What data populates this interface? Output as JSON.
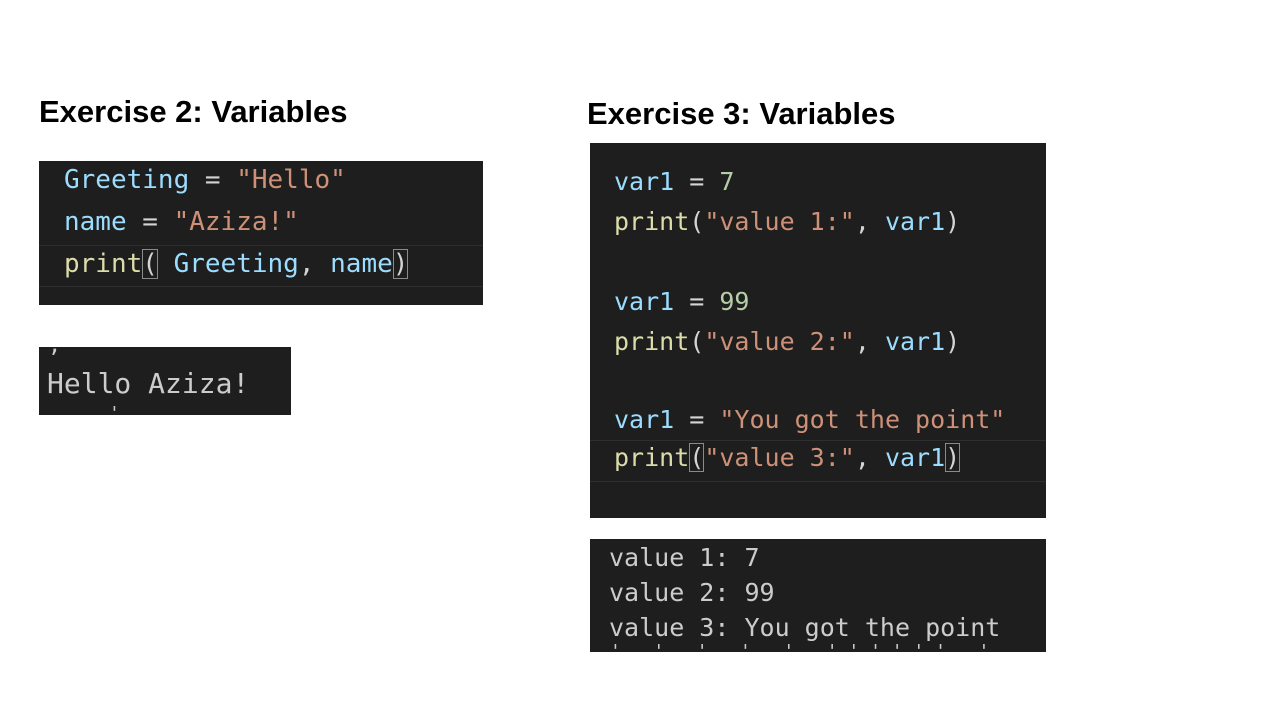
{
  "exercise2": {
    "title": "Exercise 2: Variables",
    "code": {
      "line1": {
        "var": "Greeting",
        "op": " = ",
        "str": "\"Hello\""
      },
      "line2": {
        "var": "name",
        "op": " = ",
        "str": "\"Aziza!\""
      },
      "line3": {
        "fn": "print",
        "open": "(",
        "arg1": " Greeting",
        "comma": ", ",
        "arg2": "name",
        "close": ")"
      }
    },
    "output": [
      "Hello Aziza!"
    ]
  },
  "exercise3": {
    "title": "Exercise 3: Variables",
    "code": {
      "line1": {
        "var": "var1",
        "op": " = ",
        "num": "7"
      },
      "line2": {
        "fn": "print",
        "open": "(",
        "str": "\"value 1:\"",
        "comma": ", ",
        "arg": "var1",
        "close": ")"
      },
      "line3": {
        "var": "var1",
        "op": " = ",
        "num": "99"
      },
      "line4": {
        "fn": "print",
        "open": "(",
        "str": "\"value 2:\"",
        "comma": ", ",
        "arg": "var1",
        "close": ")"
      },
      "line5": {
        "var": "var1",
        "op": " = ",
        "str": "\"You got the point\""
      },
      "line6": {
        "fn": "print",
        "open": "(",
        "str": "\"value 3:\"",
        "comma": ", ",
        "arg": "var1",
        "close": ")"
      }
    },
    "output": [
      "value 1: 7",
      "value 2: 99",
      "value 3: You got the point"
    ]
  },
  "colors": {
    "panel_bg": "#1e1e1e",
    "variable": "#9cdcfe",
    "string": "#ce9178",
    "number": "#b5cea8",
    "function": "#dcdcaa",
    "text": "#d4d4d4",
    "terminal_text": "#cccccc"
  }
}
